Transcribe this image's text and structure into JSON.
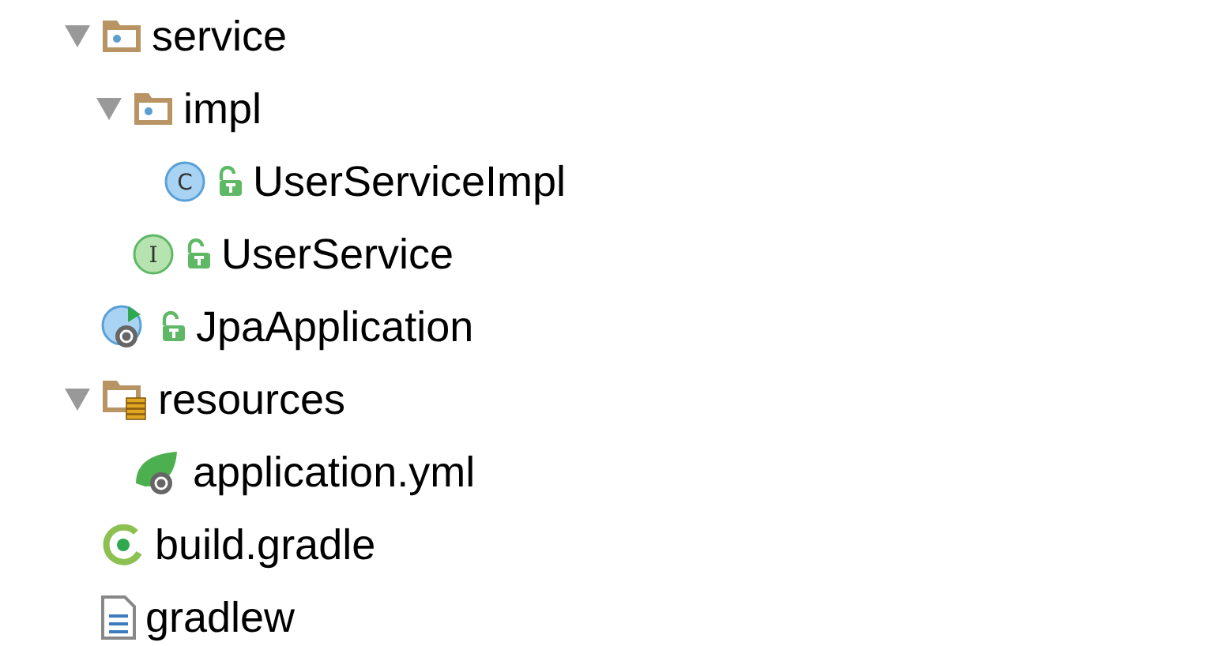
{
  "tree": [
    {
      "label": "service",
      "kind": "package",
      "expanded": true,
      "children": [
        {
          "label": "impl",
          "kind": "package",
          "expanded": true,
          "children": [
            {
              "label": "UserServiceImpl",
              "kind": "class",
              "badge": "C"
            }
          ]
        },
        {
          "label": "UserService",
          "kind": "interface",
          "badge": "I"
        }
      ]
    },
    {
      "label": "JpaApplication",
      "kind": "app-class"
    },
    {
      "label": "resources",
      "kind": "resources",
      "expanded": true,
      "children": [
        {
          "label": "application.yml",
          "kind": "spring-config"
        }
      ]
    },
    {
      "label": "build.gradle",
      "kind": "gradle"
    },
    {
      "label": "gradlew",
      "kind": "file"
    }
  ]
}
